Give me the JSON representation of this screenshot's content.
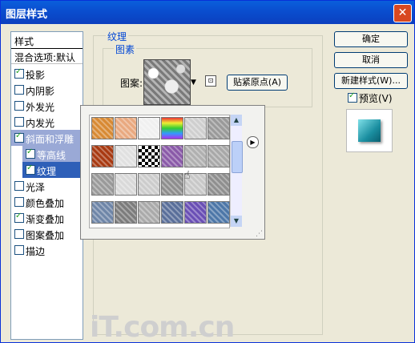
{
  "window": {
    "title": "图层样式",
    "close_glyph": "✕"
  },
  "sidebar": {
    "title": "样式",
    "blend_options": "混合选项:默认",
    "items": [
      {
        "label": "投影",
        "checked": true
      },
      {
        "label": "内阴影",
        "checked": false
      },
      {
        "label": "外发光",
        "checked": false
      },
      {
        "label": "内发光",
        "checked": false
      },
      {
        "label": "斜面和浮雕",
        "checked": true
      },
      {
        "label": "等高线",
        "checked": true
      },
      {
        "label": "纹理",
        "checked": true
      },
      {
        "label": "光泽",
        "checked": false
      },
      {
        "label": "颜色叠加",
        "checked": false
      },
      {
        "label": "渐变叠加",
        "checked": true
      },
      {
        "label": "图案叠加",
        "checked": false
      },
      {
        "label": "描边",
        "checked": false
      }
    ]
  },
  "texture_panel": {
    "group_label": "纹理",
    "sub_label": "图素",
    "pattern_label": "图案:",
    "snap_button": "贴紧原点(A)"
  },
  "buttons": {
    "ok": "确定",
    "cancel": "取消",
    "new_style": "新建样式(W)...",
    "preview": "预览(V)"
  },
  "watermark": "iT.com.cn",
  "pattern_tiles": [
    "#d88a34",
    "#e9a980",
    "#f0f0f0",
    "rainbow",
    "#cfcfcf",
    "#9a9a9a",
    "#a83a12",
    "#e0e0e0",
    "checker",
    "#8a5aa8",
    "#b0b0b0",
    "#a8a8a8",
    "#9a9a9a",
    "#d9d9d9",
    "#cccccc",
    "#8e8e8e",
    "#c8c8c8",
    "#8f8f8f",
    "#6f86a8",
    "#7c7c7c",
    "#aaaaaa",
    "#5a6f9a",
    "#6a4fb5",
    "#4d77a8"
  ]
}
